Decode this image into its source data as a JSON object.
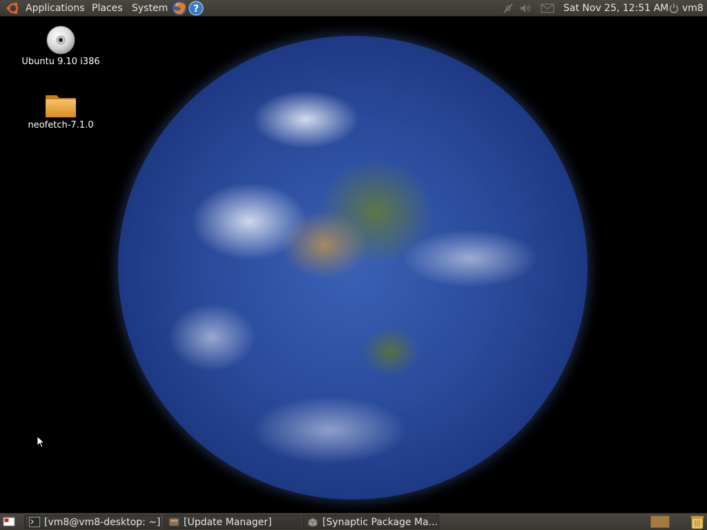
{
  "top_panel": {
    "menus": {
      "applications": "Applications",
      "places": "Places",
      "system": "System"
    },
    "launchers": [
      "firefox-icon",
      "help-icon"
    ],
    "tray": [
      "network-icon",
      "volume-icon",
      "mail-icon"
    ],
    "clock": "Sat Nov 25, 12:51 AM",
    "user": "vm8"
  },
  "desktop": {
    "wallpaper": "earth",
    "icons": [
      {
        "label": "Ubuntu 9.10 i386",
        "icon": "cdrom-icon"
      },
      {
        "label": "neofetch-7.1.0",
        "icon": "folder-icon"
      }
    ]
  },
  "bottom_panel": {
    "tasks": [
      {
        "label": "[vm8@vm8-desktop: ~]",
        "icon": "terminal-icon"
      },
      {
        "label": "[Update Manager]",
        "icon": "update-manager-icon"
      },
      {
        "label": "[Synaptic Package Ma...",
        "icon": "synaptic-icon"
      }
    ]
  },
  "colors": {
    "panel": "#3f3d38",
    "panel_text": "#e8e6e1",
    "workspace": "#a57a3e"
  }
}
